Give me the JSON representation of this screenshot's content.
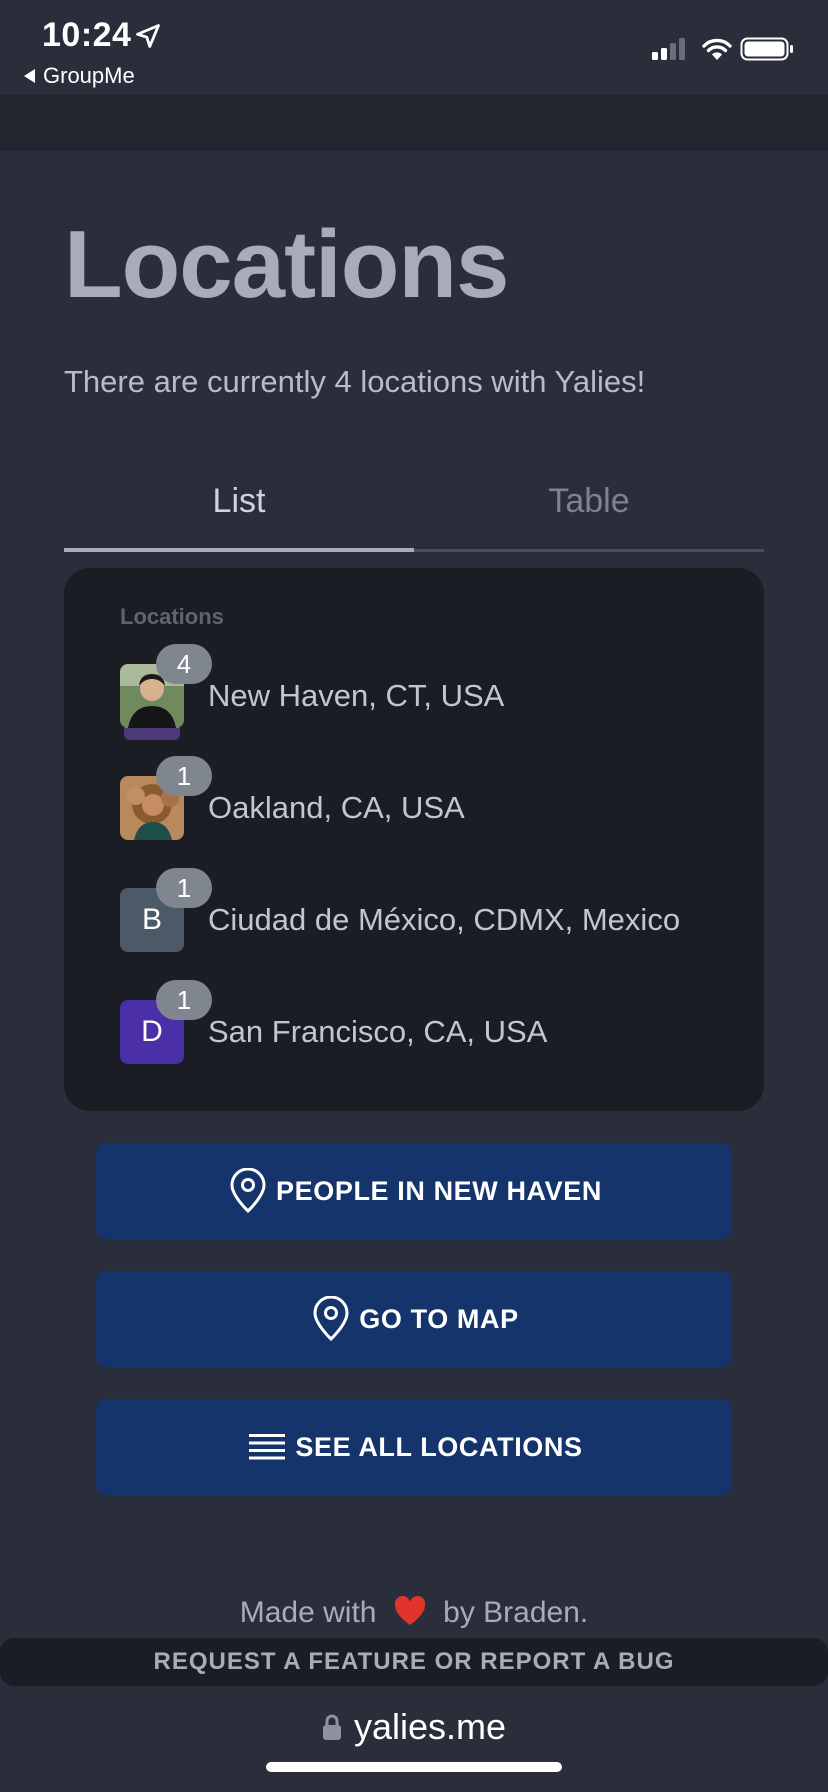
{
  "status_bar": {
    "time": "10:24",
    "back_app": "GroupMe"
  },
  "page": {
    "title": "Locations",
    "subtitle": "There are currently 4 locations with Yalies!"
  },
  "tabs": [
    {
      "label": "List",
      "active": true
    },
    {
      "label": "Table",
      "active": false
    }
  ],
  "card": {
    "header": "Locations",
    "locations": [
      {
        "name": "New Haven, CT, USA",
        "count": "4",
        "avatar_type": "photo",
        "avatar_icon": "person-photo-icon"
      },
      {
        "name": "Oakland, CA, USA",
        "count": "1",
        "avatar_type": "photo",
        "avatar_icon": "person-photo-icon"
      },
      {
        "name": "Ciudad de México, CDMX, Mexico",
        "count": "1",
        "avatar_type": "initial",
        "initial": "B",
        "avatar_color": "#4b5a66"
      },
      {
        "name": "San Francisco, CA, USA",
        "count": "1",
        "avatar_type": "initial",
        "initial": "D",
        "avatar_color": "#4a2fa8"
      }
    ]
  },
  "actions": [
    {
      "label": "PEOPLE IN NEW HAVEN",
      "icon": "map-pin-icon"
    },
    {
      "label": "GO TO MAP",
      "icon": "map-pin-icon"
    },
    {
      "label": "SEE ALL LOCATIONS",
      "icon": "list-icon"
    }
  ],
  "footer": {
    "made_with_prefix": "Made with",
    "made_with_suffix": "by Braden.",
    "report_label": "REQUEST A FEATURE OR REPORT A BUG"
  },
  "browser": {
    "url": "yalies.me"
  },
  "colors": {
    "background": "#2a2d3a",
    "card": "#1b1d25",
    "button": "#14346b",
    "badge": "#80868f",
    "heart": "#e0342c"
  }
}
